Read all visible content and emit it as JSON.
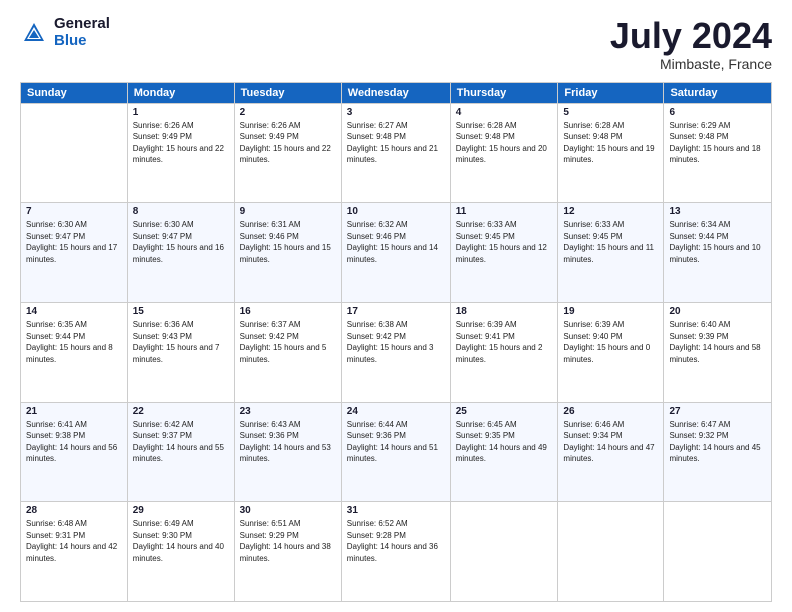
{
  "header": {
    "logo_general": "General",
    "logo_blue": "Blue",
    "title": "July 2024",
    "location": "Mimbaste, France"
  },
  "days": [
    "Sunday",
    "Monday",
    "Tuesday",
    "Wednesday",
    "Thursday",
    "Friday",
    "Saturday"
  ],
  "weeks": [
    [
      {
        "date": "",
        "sunrise": "",
        "sunset": "",
        "daylight": ""
      },
      {
        "date": "1",
        "sunrise": "Sunrise: 6:26 AM",
        "sunset": "Sunset: 9:49 PM",
        "daylight": "Daylight: 15 hours and 22 minutes."
      },
      {
        "date": "2",
        "sunrise": "Sunrise: 6:26 AM",
        "sunset": "Sunset: 9:49 PM",
        "daylight": "Daylight: 15 hours and 22 minutes."
      },
      {
        "date": "3",
        "sunrise": "Sunrise: 6:27 AM",
        "sunset": "Sunset: 9:48 PM",
        "daylight": "Daylight: 15 hours and 21 minutes."
      },
      {
        "date": "4",
        "sunrise": "Sunrise: 6:28 AM",
        "sunset": "Sunset: 9:48 PM",
        "daylight": "Daylight: 15 hours and 20 minutes."
      },
      {
        "date": "5",
        "sunrise": "Sunrise: 6:28 AM",
        "sunset": "Sunset: 9:48 PM",
        "daylight": "Daylight: 15 hours and 19 minutes."
      },
      {
        "date": "6",
        "sunrise": "Sunrise: 6:29 AM",
        "sunset": "Sunset: 9:48 PM",
        "daylight": "Daylight: 15 hours and 18 minutes."
      }
    ],
    [
      {
        "date": "7",
        "sunrise": "Sunrise: 6:30 AM",
        "sunset": "Sunset: 9:47 PM",
        "daylight": "Daylight: 15 hours and 17 minutes."
      },
      {
        "date": "8",
        "sunrise": "Sunrise: 6:30 AM",
        "sunset": "Sunset: 9:47 PM",
        "daylight": "Daylight: 15 hours and 16 minutes."
      },
      {
        "date": "9",
        "sunrise": "Sunrise: 6:31 AM",
        "sunset": "Sunset: 9:46 PM",
        "daylight": "Daylight: 15 hours and 15 minutes."
      },
      {
        "date": "10",
        "sunrise": "Sunrise: 6:32 AM",
        "sunset": "Sunset: 9:46 PM",
        "daylight": "Daylight: 15 hours and 14 minutes."
      },
      {
        "date": "11",
        "sunrise": "Sunrise: 6:33 AM",
        "sunset": "Sunset: 9:45 PM",
        "daylight": "Daylight: 15 hours and 12 minutes."
      },
      {
        "date": "12",
        "sunrise": "Sunrise: 6:33 AM",
        "sunset": "Sunset: 9:45 PM",
        "daylight": "Daylight: 15 hours and 11 minutes."
      },
      {
        "date": "13",
        "sunrise": "Sunrise: 6:34 AM",
        "sunset": "Sunset: 9:44 PM",
        "daylight": "Daylight: 15 hours and 10 minutes."
      }
    ],
    [
      {
        "date": "14",
        "sunrise": "Sunrise: 6:35 AM",
        "sunset": "Sunset: 9:44 PM",
        "daylight": "Daylight: 15 hours and 8 minutes."
      },
      {
        "date": "15",
        "sunrise": "Sunrise: 6:36 AM",
        "sunset": "Sunset: 9:43 PM",
        "daylight": "Daylight: 15 hours and 7 minutes."
      },
      {
        "date": "16",
        "sunrise": "Sunrise: 6:37 AM",
        "sunset": "Sunset: 9:42 PM",
        "daylight": "Daylight: 15 hours and 5 minutes."
      },
      {
        "date": "17",
        "sunrise": "Sunrise: 6:38 AM",
        "sunset": "Sunset: 9:42 PM",
        "daylight": "Daylight: 15 hours and 3 minutes."
      },
      {
        "date": "18",
        "sunrise": "Sunrise: 6:39 AM",
        "sunset": "Sunset: 9:41 PM",
        "daylight": "Daylight: 15 hours and 2 minutes."
      },
      {
        "date": "19",
        "sunrise": "Sunrise: 6:39 AM",
        "sunset": "Sunset: 9:40 PM",
        "daylight": "Daylight: 15 hours and 0 minutes."
      },
      {
        "date": "20",
        "sunrise": "Sunrise: 6:40 AM",
        "sunset": "Sunset: 9:39 PM",
        "daylight": "Daylight: 14 hours and 58 minutes."
      }
    ],
    [
      {
        "date": "21",
        "sunrise": "Sunrise: 6:41 AM",
        "sunset": "Sunset: 9:38 PM",
        "daylight": "Daylight: 14 hours and 56 minutes."
      },
      {
        "date": "22",
        "sunrise": "Sunrise: 6:42 AM",
        "sunset": "Sunset: 9:37 PM",
        "daylight": "Daylight: 14 hours and 55 minutes."
      },
      {
        "date": "23",
        "sunrise": "Sunrise: 6:43 AM",
        "sunset": "Sunset: 9:36 PM",
        "daylight": "Daylight: 14 hours and 53 minutes."
      },
      {
        "date": "24",
        "sunrise": "Sunrise: 6:44 AM",
        "sunset": "Sunset: 9:36 PM",
        "daylight": "Daylight: 14 hours and 51 minutes."
      },
      {
        "date": "25",
        "sunrise": "Sunrise: 6:45 AM",
        "sunset": "Sunset: 9:35 PM",
        "daylight": "Daylight: 14 hours and 49 minutes."
      },
      {
        "date": "26",
        "sunrise": "Sunrise: 6:46 AM",
        "sunset": "Sunset: 9:34 PM",
        "daylight": "Daylight: 14 hours and 47 minutes."
      },
      {
        "date": "27",
        "sunrise": "Sunrise: 6:47 AM",
        "sunset": "Sunset: 9:32 PM",
        "daylight": "Daylight: 14 hours and 45 minutes."
      }
    ],
    [
      {
        "date": "28",
        "sunrise": "Sunrise: 6:48 AM",
        "sunset": "Sunset: 9:31 PM",
        "daylight": "Daylight: 14 hours and 42 minutes."
      },
      {
        "date": "29",
        "sunrise": "Sunrise: 6:49 AM",
        "sunset": "Sunset: 9:30 PM",
        "daylight": "Daylight: 14 hours and 40 minutes."
      },
      {
        "date": "30",
        "sunrise": "Sunrise: 6:51 AM",
        "sunset": "Sunset: 9:29 PM",
        "daylight": "Daylight: 14 hours and 38 minutes."
      },
      {
        "date": "31",
        "sunrise": "Sunrise: 6:52 AM",
        "sunset": "Sunset: 9:28 PM",
        "daylight": "Daylight: 14 hours and 36 minutes."
      },
      {
        "date": "",
        "sunrise": "",
        "sunset": "",
        "daylight": ""
      },
      {
        "date": "",
        "sunrise": "",
        "sunset": "",
        "daylight": ""
      },
      {
        "date": "",
        "sunrise": "",
        "sunset": "",
        "daylight": ""
      }
    ]
  ]
}
